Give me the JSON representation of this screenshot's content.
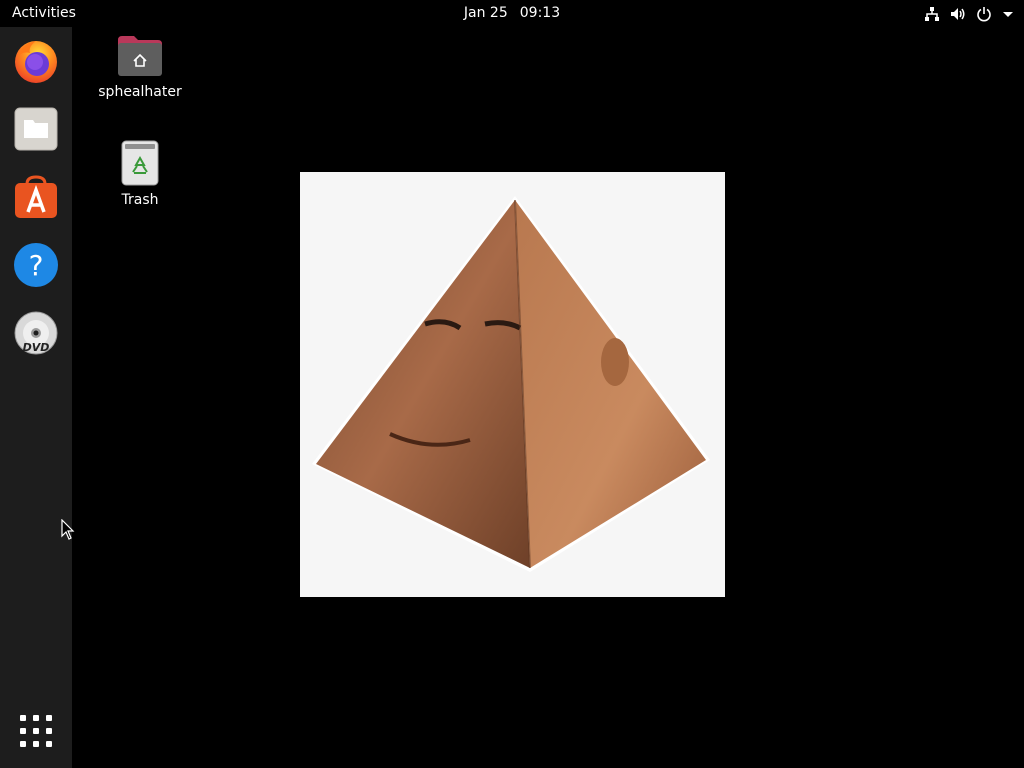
{
  "topbar": {
    "activities_label": "Activities",
    "date": "Jan 25",
    "time": "09:13",
    "tray_icons": [
      "network-icon",
      "volume-icon",
      "power-icon",
      "menu-arrow-icon"
    ]
  },
  "dock": {
    "items": [
      {
        "name": "Firefox",
        "icon": "firefox-icon"
      },
      {
        "name": "Files",
        "icon": "files-icon"
      },
      {
        "name": "Ubuntu Software",
        "icon": "software-store-icon"
      },
      {
        "name": "Help",
        "icon": "help-icon"
      },
      {
        "name": "DVD",
        "icon": "dvd-icon",
        "badge": "DVD"
      },
      {
        "name": "Show Applications",
        "icon": "app-grid-icon"
      }
    ]
  },
  "desktop": {
    "icons": [
      {
        "label": "sphealhater",
        "icon": "home-folder-icon"
      },
      {
        "label": "Trash",
        "icon": "trash-icon"
      }
    ]
  },
  "image_viewer": {
    "content": "pyramid-face-image"
  },
  "colors": {
    "topbar_bg": "#000000",
    "dock_bg": "#1d1d1d",
    "desktop_bg": "#000000",
    "accent_orange": "#e95420",
    "help_blue": "#1e88e5"
  }
}
